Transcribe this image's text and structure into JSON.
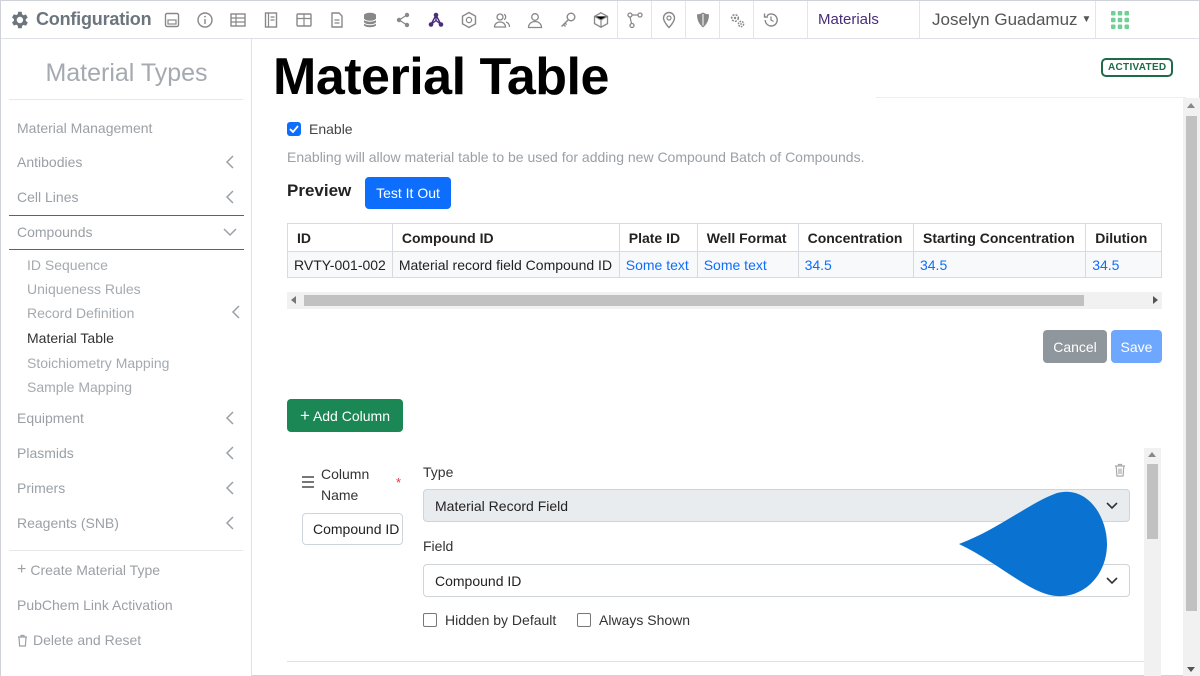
{
  "topbar": {
    "brand": "Configuration",
    "icons": [
      "dashboard-icon",
      "info-icon",
      "table-icon",
      "notebook-icon",
      "grid-table-icon",
      "document-icon",
      "database-icon",
      "share-icon",
      "molecule-icon",
      "badge-icon",
      "users-icon",
      "user-icon",
      "key-icon",
      "cube-icon",
      "workflow-icon",
      "location-pin-icon",
      "shield-icon",
      "settings-gears-icon",
      "history-icon"
    ],
    "context": "Materials",
    "user": "Joselyn Guadamuz",
    "accent": "#4b2c7a"
  },
  "sidebar": {
    "title": "Material Types",
    "items": [
      {
        "label": "Material Management",
        "chevron": false
      },
      {
        "label": "Antibodies",
        "chevron": "left"
      },
      {
        "label": "Cell Lines",
        "chevron": "left"
      },
      {
        "label": "Compounds",
        "chevron": "down"
      },
      {
        "label": "Equipment",
        "chevron": "left"
      },
      {
        "label": "Plasmids",
        "chevron": "left"
      },
      {
        "label": "Primers",
        "chevron": "left"
      },
      {
        "label": "Reagents (SNB)",
        "chevron": "left"
      }
    ],
    "subitems": [
      {
        "label": "ID Sequence"
      },
      {
        "label": "Uniqueness Rules"
      },
      {
        "label": "Record Definition",
        "chevron": "left"
      },
      {
        "label": "Material Table",
        "active": true
      },
      {
        "label": "Stoichiometry Mapping"
      },
      {
        "label": "Sample Mapping"
      }
    ],
    "actions": [
      {
        "label": "Create Material Type",
        "icon": "plus-icon"
      },
      {
        "label": "PubChem Link Activation"
      },
      {
        "label": "Delete and Reset",
        "icon": "trash-icon"
      }
    ]
  },
  "main": {
    "title": "Material Table",
    "status_badge": "ACTIVATED",
    "enable_label": "Enable",
    "enable_checked": true,
    "help_text": "Enabling will allow material table to be used for adding new Compound Batch of Compounds.",
    "preview_label": "Preview",
    "test_button": "Test It Out",
    "table": {
      "headers": [
        "ID",
        "Compound ID",
        "Plate ID",
        "Well Format",
        "Concentration",
        "Starting Concentration",
        "Dilution"
      ],
      "rows": [
        [
          "RVTY-001-002",
          "Material record field Compound ID",
          "Some text",
          "Some text",
          "34.5",
          "34.5",
          "34.5"
        ]
      ]
    },
    "cancel_button": "Cancel",
    "save_button": "Save",
    "add_column_button": "Add Column",
    "column": {
      "name_label": "Column Name",
      "required_mark": "*",
      "name_value": "Compound ID",
      "type_label": "Type",
      "type_value": "Material Record Field",
      "field_label": "Field",
      "field_value": "Compound ID",
      "hidden_label": "Hidden by Default",
      "always_label": "Always Shown"
    }
  }
}
